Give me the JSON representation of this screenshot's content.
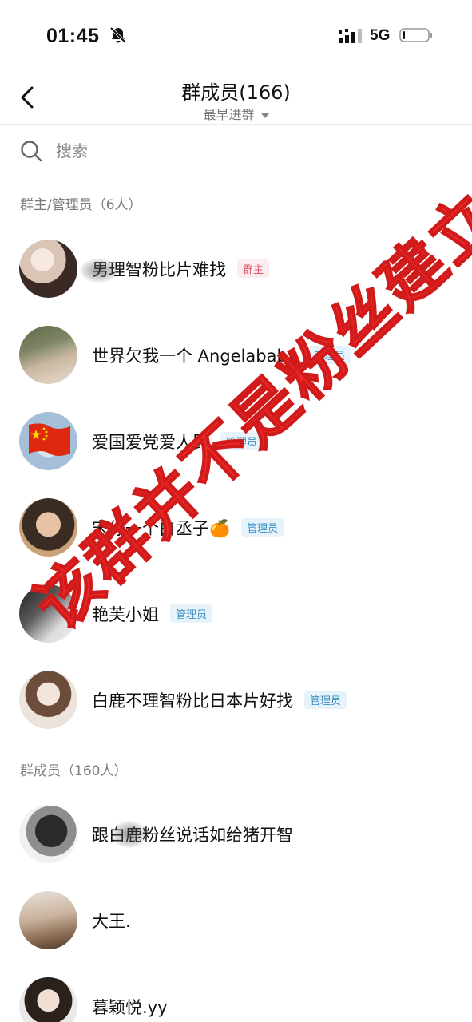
{
  "status_bar": {
    "time": "01:45",
    "network": "5G",
    "icons": [
      "bell-muted-icon",
      "signal-icon",
      "battery-icon"
    ]
  },
  "nav": {
    "back_icon": "chevron-left-icon",
    "title": "群成员(166)",
    "sort_label": "最早进群"
  },
  "search": {
    "placeholder": "搜索",
    "icon": "search-icon"
  },
  "sections": [
    {
      "header": "群主/管理员（6人）",
      "members": [
        {
          "name": "男理智粉比片难找",
          "badge": "群主",
          "badge_type": "owner"
        },
        {
          "name": "世界欠我一个 Angelababy",
          "badge": "管理员",
          "badge_type": "admin"
        },
        {
          "name": "爱国爱党爱人民",
          "badge": "管理员",
          "badge_type": "admin"
        },
        {
          "name": "宋你一个白丞子🍊",
          "badge": "管理员",
          "badge_type": "admin"
        },
        {
          "name": "艳芙小姐",
          "badge": "管理员",
          "badge_type": "admin"
        },
        {
          "name": "白鹿不理智粉比日本片好找",
          "badge": "管理员",
          "badge_type": "admin"
        }
      ]
    },
    {
      "header": "群成员（160人）",
      "members": [
        {
          "name": "跟白鹿粉丝说话如给猪开智"
        },
        {
          "name": "大王."
        },
        {
          "name": "暮颖悦.yy"
        }
      ]
    }
  ],
  "watermark": {
    "text": "该群并不是粉丝建立",
    "color": "#ec2b2b"
  },
  "colors": {
    "owner_badge_text": "#e4546f",
    "owner_badge_bg": "#fdecef",
    "admin_badge_text": "#3b8ec2",
    "admin_badge_bg": "#e6f3fb"
  }
}
